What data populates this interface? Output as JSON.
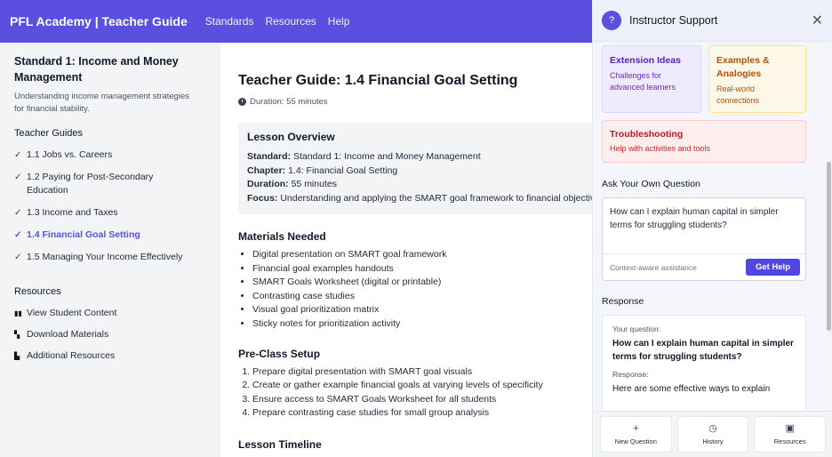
{
  "nav": {
    "brand": "PFL Academy | Teacher Guide",
    "links": [
      "Standards",
      "Resources",
      "Help"
    ]
  },
  "sidebar": {
    "standard_title": "Standard 1: Income and Money Management",
    "standard_desc": "Understanding income management strategies for financial stability.",
    "guides_heading": "Teacher Guides",
    "guides": [
      {
        "label": "1.1 Jobs vs. Careers",
        "icon": "check-icon"
      },
      {
        "label": "1.2 Paying for Post-Secondary Education",
        "icon": "check-icon"
      },
      {
        "label": "1.3 Income and Taxes",
        "icon": "check-icon"
      },
      {
        "label": "1.4 Financial Goal Setting",
        "icon": "check-icon",
        "active": true
      },
      {
        "label": "1.5 Managing Your Income Effectively",
        "icon": "check-icon"
      }
    ],
    "resources_heading": "Resources",
    "resources": [
      {
        "label": "View Student Content",
        "icon": "book-icon"
      },
      {
        "label": "Download Materials",
        "icon": "copy-icon"
      },
      {
        "label": "Additional Resources",
        "icon": "document-icon"
      }
    ]
  },
  "main": {
    "title": "Teacher Guide: 1.4 Financial Goal Setting",
    "duration": "Duration: 55 minutes",
    "overview": {
      "heading": "Lesson Overview",
      "rows": [
        {
          "key": "Standard:",
          "value": "Standard 1: Income and Money Management"
        },
        {
          "key": "Chapter:",
          "value": "1.4: Financial Goal Setting"
        },
        {
          "key": "Duration:",
          "value": "55 minutes"
        },
        {
          "key": "Focus:",
          "value": "Understanding and applying the SMART goal framework to financial objectives"
        }
      ]
    },
    "materials_heading": "Materials Needed",
    "materials": [
      "Digital presentation on SMART goal framework",
      "Financial goal examples handouts",
      "SMART Goals Worksheet (digital or printable)",
      "Contrasting case studies",
      "Visual goal prioritization matrix",
      "Sticky notes for prioritization activity"
    ],
    "preclass_heading": "Pre-Class Setup",
    "preclass": [
      "Prepare digital presentation with SMART goal visuals",
      "Create or gather example financial goals at varying levels of specificity",
      "Ensure access to SMART Goals Worksheet for all students",
      "Prepare contrasting case studies for small group analysis"
    ],
    "timeline_heading": "Lesson Timeline"
  },
  "panel": {
    "title": "Instructor Support",
    "cards": [
      {
        "title": "Extension Ideas",
        "desc": "Challenges for advanced learners"
      },
      {
        "title": "Examples & Analogies",
        "desc": "Real-world connections"
      }
    ],
    "trouble": {
      "title": "Troubleshooting",
      "desc": "Help with activities and tools"
    },
    "ask_heading": "Ask Your Own Question",
    "question_text": "How can I explain human capital in simpler terms for struggling students?",
    "context_note": "Context-aware assistance",
    "get_help": "Get Help",
    "response_heading": "Response",
    "response": {
      "q_label": "Your question:",
      "question": "How can I explain human capital in simpler terms for struggling students?",
      "a_label": "Response:",
      "answer": "Here are some effective ways to explain"
    },
    "footer": [
      {
        "label": "New Question",
        "icon": "plus-icon"
      },
      {
        "label": "History",
        "icon": "clock-icon"
      },
      {
        "label": "Resources",
        "icon": "image-icon"
      }
    ]
  }
}
